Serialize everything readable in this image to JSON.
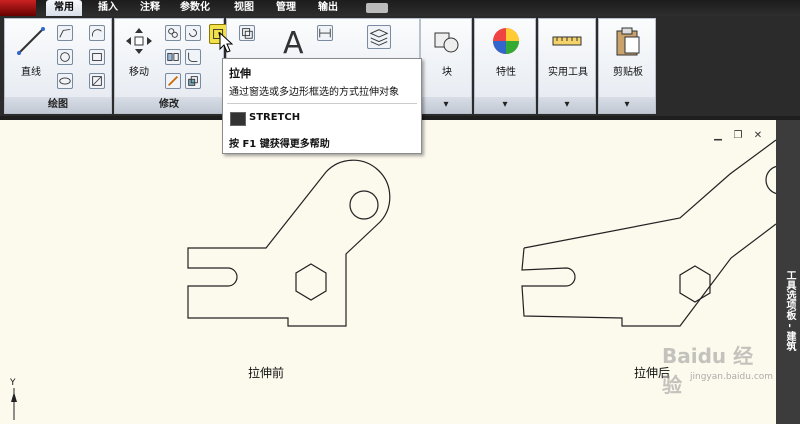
{
  "menu_tabs": [
    "常用",
    "插入",
    "注释",
    "参数化",
    "视图",
    "管理",
    "输出"
  ],
  "panels": {
    "draw": {
      "title": "绘图",
      "line_label": "直线"
    },
    "modify": {
      "title": "修改",
      "move_label": "移动"
    },
    "block": {
      "label": "块"
    },
    "properties": {
      "label": "特性"
    },
    "utilities": {
      "label": "实用工具"
    },
    "clipboard": {
      "label": "剪贴板"
    }
  },
  "tooltip": {
    "title": "拉伸",
    "description": "通过窗选或多边形框选的方式拉伸对象",
    "command": "STRETCH",
    "help": "按 F1 键获得更多帮助"
  },
  "canvas": {
    "caption_before": "拉伸前",
    "caption_after": "拉伸后",
    "axis_y": "Y"
  },
  "tool_palette_label": "工具选项板 - 建筑",
  "watermark": {
    "brand": "Baidu 经验",
    "url": "jingyan.baidu.com"
  },
  "colors": {
    "canvas_bg": "#fcf9ed",
    "ribbon_bg": "#e4e9f0",
    "highlight": "#f2e14a"
  }
}
